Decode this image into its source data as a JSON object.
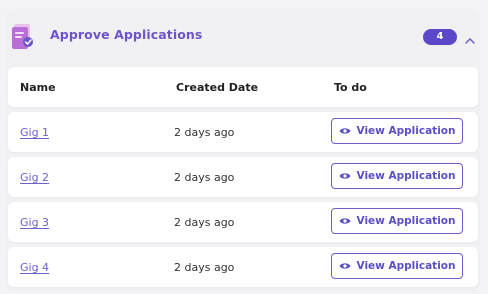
{
  "header": {
    "title": "Approve Applications",
    "count": "4",
    "icon": "applications-document-icon",
    "collapse_icon": "chevron-up-icon"
  },
  "table": {
    "columns": [
      "Name",
      "Created Date",
      "To do"
    ],
    "rows": [
      {
        "name": "Gig 1",
        "created": "2 days ago",
        "action": "View Application"
      },
      {
        "name": "Gig 2",
        "created": "2 days ago",
        "action": "View Application"
      },
      {
        "name": "Gig 3",
        "created": "2 days ago",
        "action": "View Application"
      },
      {
        "name": "Gig 4",
        "created": "2 days ago",
        "action": "View Application"
      }
    ]
  },
  "colors": {
    "accent": "#6c55c9",
    "badge": "#5a48c8",
    "link": "#6b63c9"
  }
}
